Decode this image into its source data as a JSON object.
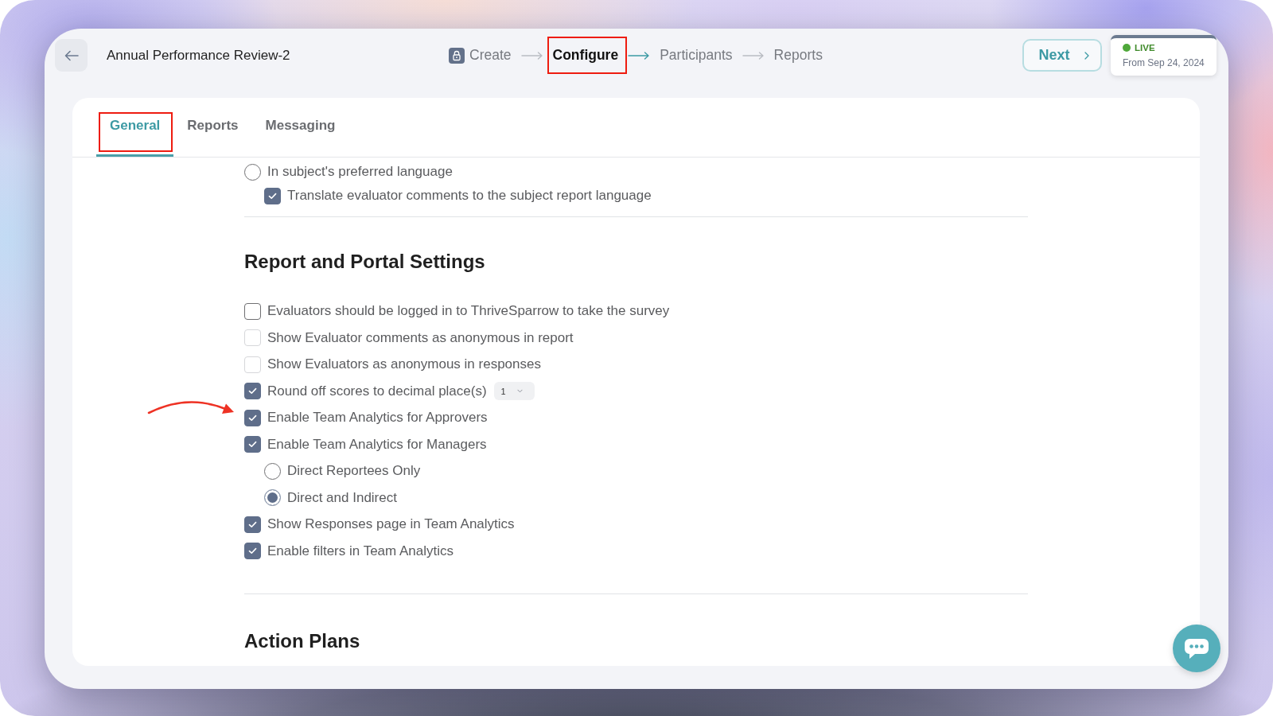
{
  "header": {
    "title": "Annual Performance Review-2",
    "steps": [
      {
        "label": "Create",
        "selected": false,
        "locked": true,
        "highlighted": false
      },
      {
        "label": "Configure",
        "selected": true,
        "locked": false,
        "highlighted": true
      },
      {
        "label": "Participants",
        "selected": false,
        "locked": false,
        "highlighted": false
      },
      {
        "label": "Reports",
        "selected": false,
        "locked": false,
        "highlighted": false
      }
    ],
    "next_button": {
      "label": "Next"
    },
    "status": {
      "label": "LIVE",
      "detail": "From Sep 24, 2024"
    }
  },
  "tabs": [
    {
      "label": "General",
      "selected": true,
      "highlighted": true
    },
    {
      "label": "Reports",
      "selected": false,
      "highlighted": false
    },
    {
      "label": "Messaging",
      "selected": false,
      "highlighted": false
    }
  ],
  "preceding_options": [
    {
      "kind": "radio",
      "label": "In subject's preferred language",
      "selected": false,
      "arrow": false,
      "children": [
        {
          "kind": "checkbox",
          "label": "Translate evaluator comments to the subject report language",
          "checked": true,
          "disabled": false,
          "arrow": false
        }
      ]
    }
  ],
  "sections": [
    {
      "title": "Report and Portal Settings",
      "options": [
        {
          "kind": "checkbox",
          "label": "Evaluators should be logged in to ThriveSparrow to take the survey",
          "checked": false,
          "disabled": false,
          "arrow": false
        },
        {
          "kind": "checkbox",
          "label": "Show Evaluator comments as anonymous in report",
          "checked": false,
          "disabled": true,
          "arrow": false
        },
        {
          "kind": "checkbox",
          "label": "Show Evaluators as anonymous in responses",
          "checked": false,
          "disabled": true,
          "arrow": false
        },
        {
          "kind": "checkbox",
          "label": "Round off scores to decimal place(s)",
          "checked": true,
          "disabled": false,
          "arrow": false,
          "select": {
            "value": "1"
          }
        },
        {
          "kind": "checkbox",
          "label": "Enable Team Analytics for Approvers",
          "checked": true,
          "disabled": false,
          "arrow": true
        },
        {
          "kind": "checkbox",
          "label": "Enable Team Analytics for Managers",
          "checked": true,
          "disabled": false,
          "arrow": false,
          "children": [
            {
              "kind": "radio",
              "label": "Direct Reportees Only",
              "selected": false,
              "arrow": false
            },
            {
              "kind": "radio",
              "label": "Direct and Indirect",
              "selected": true,
              "arrow": false
            }
          ]
        },
        {
          "kind": "checkbox",
          "label": "Show Responses page in Team Analytics",
          "checked": true,
          "disabled": false,
          "arrow": false
        },
        {
          "kind": "checkbox",
          "label": "Enable filters in Team Analytics",
          "checked": true,
          "disabled": false,
          "arrow": false
        }
      ]
    },
    {
      "title": "Action Plans"
    }
  ]
}
